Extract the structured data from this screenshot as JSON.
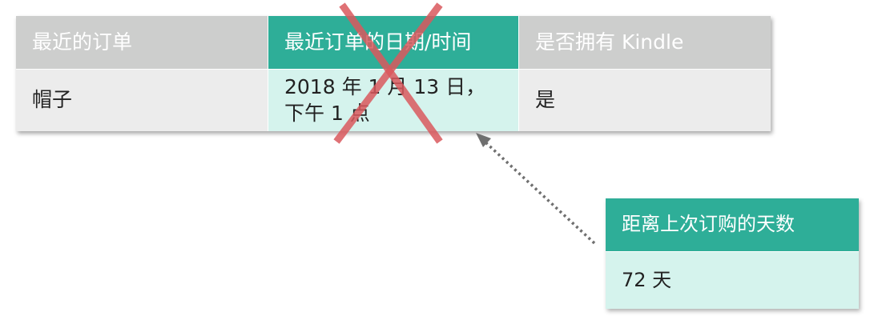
{
  "main_table": {
    "headers": [
      "最近的订单",
      "最近订单的日期/时间",
      "是否拥有 Kindle"
    ],
    "row": [
      "帽子",
      "2018 年 1 月 13 日，下午 1 点",
      "是"
    ]
  },
  "side_table": {
    "header": "距离上次订购的天数",
    "value": "72 天"
  },
  "colors": {
    "accent_header": "#2eae98",
    "accent_cell": "#d5f3ed",
    "header_gray": "#cdcecd",
    "cell_gray": "#ececec",
    "cross": "#d9585d",
    "arrow": "#6f6f6f"
  },
  "icons": {
    "cross_mark": "cross-out-icon",
    "arrow": "dotted-arrow-icon"
  }
}
